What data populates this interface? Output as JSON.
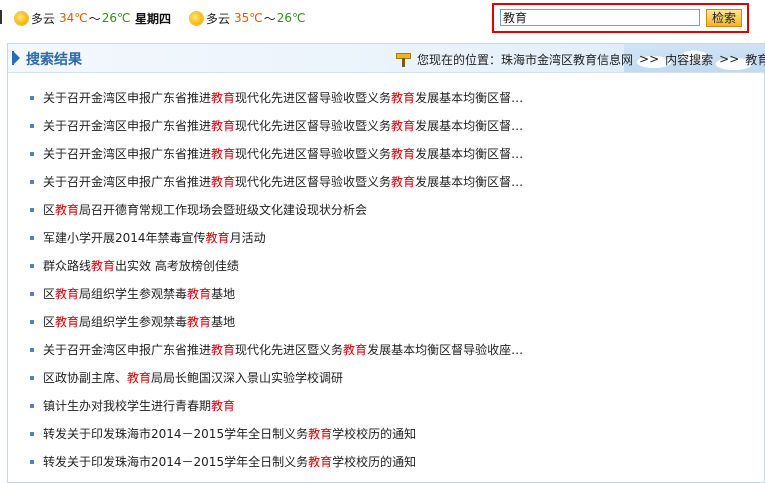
{
  "weather": [
    {
      "icon": "sun-icon",
      "condition": "多云",
      "high": "34℃",
      "tilde": "～",
      "low": "26℃"
    },
    {
      "icon": "sun-icon",
      "condition": "多云",
      "high": "35℃",
      "tilde": "～",
      "low": "26℃"
    }
  ],
  "weekday": "星期四",
  "search": {
    "value": "教育",
    "button_label": "检索"
  },
  "panel": {
    "title": "搜索结果",
    "location_label": "您现在的位置：",
    "breadcrumb": [
      "珠海市金湾区教育信息网",
      ">>",
      "内容搜索",
      ">>",
      "教育"
    ]
  },
  "results": [
    [
      "关于召开金湾区申报广东省推进",
      "教育",
      "现代化先进区督导验收暨义务",
      "教育",
      "发展基本均衡区督…"
    ],
    [
      "关于召开金湾区申报广东省推进",
      "教育",
      "现代化先进区督导验收暨义务",
      "教育",
      "发展基本均衡区督…"
    ],
    [
      "关于召开金湾区申报广东省推进",
      "教育",
      "现代化先进区督导验收暨义务",
      "教育",
      "发展基本均衡区督…"
    ],
    [
      "关于召开金湾区申报广东省推进",
      "教育",
      "现代化先进区督导验收暨义务",
      "教育",
      "发展基本均衡区督…"
    ],
    [
      "区",
      "教育",
      "局召开德育常规工作现场会暨班级文化建设现状分析会",
      "",
      ""
    ],
    [
      "军建小学开展2014年禁毒宣传",
      "教育",
      "月活动",
      "",
      ""
    ],
    [
      "群众路线",
      "教育",
      "出实效 高考放榜创佳绩",
      "",
      ""
    ],
    [
      "区",
      "教育",
      "局组织学生参观禁毒",
      "教育",
      "基地"
    ],
    [
      "区",
      "教育",
      "局组织学生参观禁毒",
      "教育",
      "基地"
    ],
    [
      "关于召开金湾区申报广东省推进",
      "教育",
      "现代化先进区暨义务",
      "教育",
      "发展基本均衡区督导验收座…"
    ],
    [
      "区政协副主席、",
      "教育",
      "局局长鲍国汉深入景山实验学校调研",
      "",
      ""
    ],
    [
      "镇计生办对我校学生进行青春期",
      "教育",
      "",
      "",
      ""
    ],
    [
      "转发关于印发珠海市2014－2015学年全日制义务",
      "教育",
      "学校校历的通知",
      "",
      ""
    ],
    [
      "转发关于印发珠海市2014－2015学年全日制义务",
      "教育",
      "学校校历的通知",
      "",
      ""
    ]
  ]
}
